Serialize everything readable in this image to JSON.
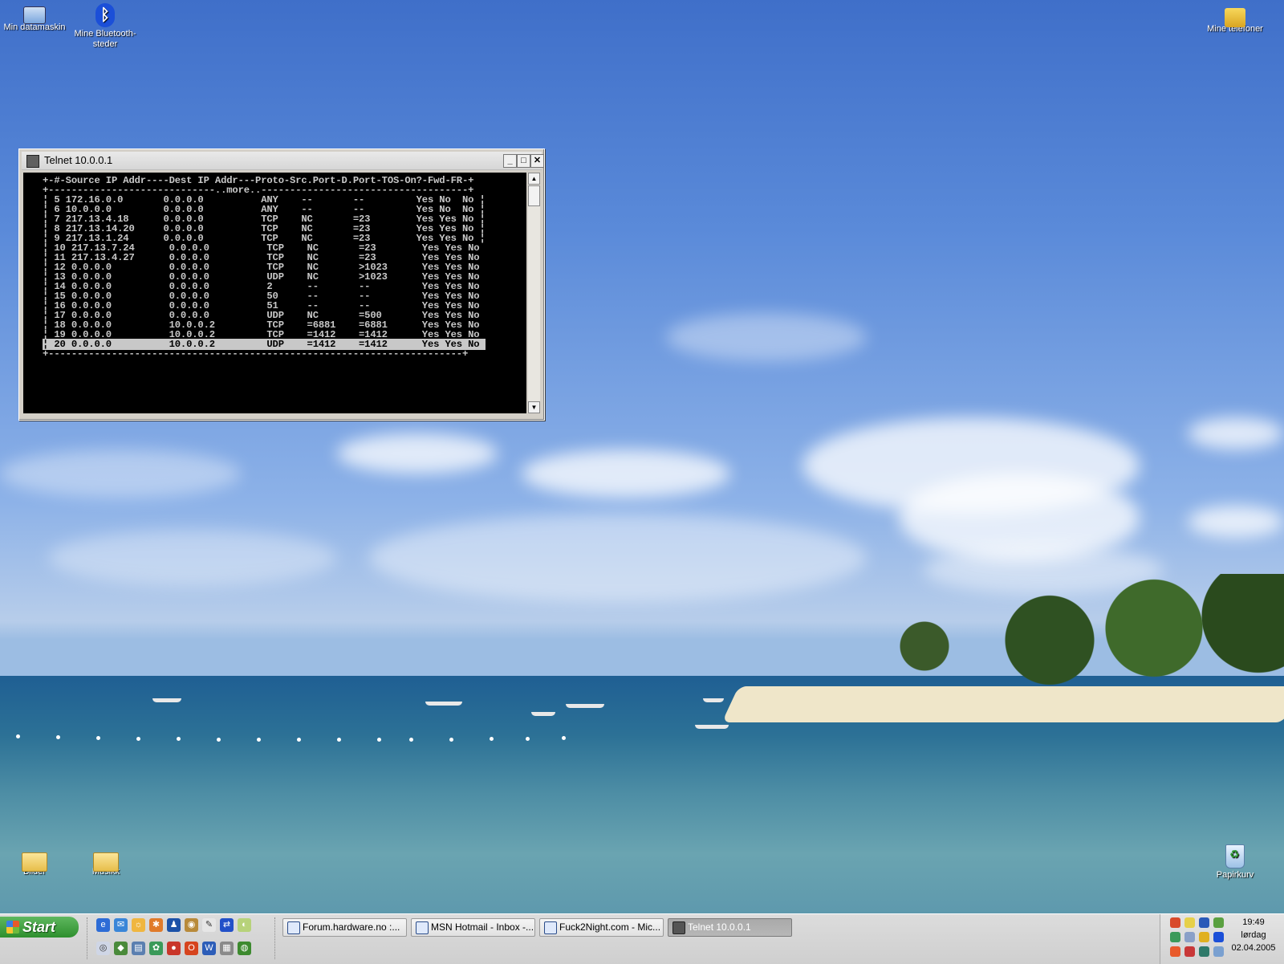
{
  "desktop": {
    "icons_top": [
      {
        "label": "Min datamaskin"
      },
      {
        "label": "Mine Bluetooth-steder"
      },
      {
        "label": "Mine telefoner"
      }
    ],
    "icons_bottom": [
      {
        "label": "Bilder"
      },
      {
        "label": "Musikk"
      },
      {
        "label": "Papirkurv"
      }
    ]
  },
  "telnet": {
    "title": "Telnet 10.0.0.1",
    "buttons": {
      "minimize": "_",
      "maximize": "□",
      "close": "✕"
    },
    "scroll": {
      "up": "▲",
      "down": "▼"
    },
    "header": "+-#-Source IP Addr----Dest IP Addr---Proto-Src.Port-D.Port-TOS-On?-Fwd-FR-+",
    "more": "+-----------------------------..more..------------------------------------+",
    "rows": [
      "¦ 5 172.16.0.0       0.0.0.0          ANY    --       --         Yes No  No ¦",
      "¦ 6 10.0.0.0         0.0.0.0          ANY    --       --         Yes No  No ¦",
      "¦ 7 217.13.4.18      0.0.0.0          TCP    NC       =23        Yes Yes No ¦",
      "¦ 8 217.13.14.20     0.0.0.0          TCP    NC       =23        Yes Yes No ¦",
      "¦ 9 217.13.1.24      0.0.0.0          TCP    NC       =23        Yes Yes No ¦",
      "¦ 10 217.13.7.24      0.0.0.0          TCP    NC       =23        Yes Yes No",
      "¦ 11 217.13.4.27      0.0.0.0          TCP    NC       =23        Yes Yes No",
      "¦ 12 0.0.0.0          0.0.0.0          TCP    NC       >1023      Yes Yes No",
      "¦ 13 0.0.0.0          0.0.0.0          UDP    NC       >1023      Yes Yes No",
      "¦ 14 0.0.0.0          0.0.0.0          2      --       --         Yes Yes No",
      "¦ 15 0.0.0.0          0.0.0.0          50     --       --         Yes Yes No",
      "¦ 16 0.0.0.0          0.0.0.0          51     --       --         Yes Yes No",
      "¦ 17 0.0.0.0          0.0.0.0          UDP    NC       =500       Yes Yes No",
      "¦ 18 0.0.0.0          10.0.0.2         TCP    =6881    =6881      Yes Yes No",
      "¦ 19 0.0.0.0          10.0.0.2         TCP    =1412    =1412      Yes Yes No"
    ],
    "selected_row": "¦ 20 0.0.0.0          10.0.0.2         UDP    =1412    =1412      Yes Yes No ",
    "footer": "+------------------------------------------------------------------------+"
  },
  "taskbar": {
    "start": "Start",
    "tasks": [
      {
        "label": "Forum.hardware.no :..."
      },
      {
        "label": "MSN Hotmail - Inbox -..."
      },
      {
        "label": "Fuck2Night.com - Mic..."
      },
      {
        "label": "Telnet 10.0.0.1"
      }
    ],
    "clock": {
      "time": "19:49",
      "day": "lørdag",
      "date": "02.04.2005"
    }
  },
  "colors": {
    "console_bg": "#000000",
    "console_fg": "#c8c8c8",
    "start_green": "#2d8f2d",
    "taskbar": "#d4d4d4"
  }
}
